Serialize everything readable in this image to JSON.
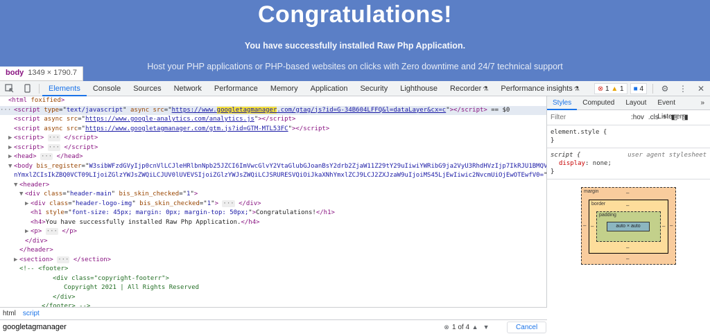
{
  "banner": {
    "title": "Congratulations!",
    "subtitle": "You have successfully installed Raw Php Application.",
    "text": "Host your PHP applications or PHP-based websites on clicks with Zero downtime and 24/7 technical support"
  },
  "tooltip": {
    "tag": "body",
    "dims": "1349 × 1790.7"
  },
  "devtools": {
    "tabs": [
      "Elements",
      "Console",
      "Sources",
      "Network",
      "Performance",
      "Memory",
      "Application",
      "Security",
      "Lighthouse",
      "Recorder",
      "Performance insights"
    ],
    "badges": {
      "errors": "1",
      "warnings": "1",
      "messages": "4"
    }
  },
  "dom": [
    {
      "indent": 0,
      "html": "<span class='tag'>&lt;html</span> <span class='attr'>foxified</span><span class='tag'>&gt;</span>"
    },
    {
      "indent": 1,
      "sel": true,
      "html": "<span class='tag'>&lt;script</span> <span class='attr'>type</span>=\"<span class='val'>text/javascript</span>\" <span class='attr'>async</span> <span class='attr'>src</span>=\"<span class='link'>https://www.<span class='hl'>googletagmanager</span>.com/gtag/js?id=G-34B604LFFQ&amp;l=dataLayer&amp;cx=c</span>\"<span class='tag'>&gt;&lt;/script&gt;</span> <span class='txt'>== $0</span>",
      "prefix": "···"
    },
    {
      "indent": 1,
      "html": "<span class='tag'>&lt;script</span> <span class='attr'>async</span> <span class='attr'>src</span>=\"<span class='link'>https://www.google-analytics.com/analytics.js</span>\"<span class='tag'>&gt;&lt;/script&gt;</span>"
    },
    {
      "indent": 1,
      "html": "<span class='tag'>&lt;script</span> <span class='attr'>async</span> <span class='attr'>src</span>=\"<span class='link'>https://www.googletagmanager.com/gtm.js?id=GTM-MTL53FC</span>\"<span class='tag'>&gt;&lt;/script&gt;</span>"
    },
    {
      "indent": 1,
      "arrow": "▶",
      "html": "<span class='tag'>&lt;script&gt;</span> <span class='dots'>···</span> <span class='tag'>&lt;/script&gt;</span>"
    },
    {
      "indent": 1,
      "arrow": "▶",
      "html": "<span class='tag'>&lt;script&gt;</span> <span class='dots'>···</span> <span class='tag'>&lt;/script&gt;</span>"
    },
    {
      "indent": 1,
      "arrow": "▶",
      "html": "<span class='tag'>&lt;head&gt;</span> <span class='dots'>···</span> <span class='tag'>&lt;/head&gt;</span>"
    },
    {
      "indent": 1,
      "arrow": "▼",
      "html": "<span class='tag'>&lt;body</span> <span class='attr'>bis_register</span>=\"<span class='val'>W3sibWFzdGVyIjp0cnVlLCJleHRlbnNpb25JZCI6ImVwcGlvY2VtaGlubGJoanBsY2drb2ZjaW11Z29tY29uIiwiYWRibG9ja2VyU3RhdHVzIjp7IkRJU1BMQVkiOiJkaXN</span>"
    },
    {
      "indent": 1,
      "html": "<span class='val'>nYmxlZCIsIkZBQ0VCT09LIjoiZGlzYWJsZWQiLCJUV0lUVEVSIjoiZGlzYWJsZWQiLCJSRURESVQiOiJkaXNhYmxlZCJ9LCJ2ZXJzaW9uIjoiMS45LjEwIiwic2NvcmUiOjEwOTEwfV0=</span>\" <span class='attr'>data-new-gr-c-s-check-loaded</span>=\"<span class='val'>14.1111.0</span>\" <span class='attr'>data-gr-ext-installed</span> <span class='attr'>cz-shortcut-listen</span>=\"<span class='val'>true</span>\"<span class='tag'>&gt;</span>"
    },
    {
      "indent": 2,
      "arrow": "▼",
      "html": "<span class='tag'>&lt;header&gt;</span>"
    },
    {
      "indent": 3,
      "arrow": "▼",
      "html": "<span class='tag'>&lt;div</span> <span class='attr'>class</span>=\"<span class='val'>header-main</span>\" <span class='attr'>bis_skin_checked</span>=\"<span class='val'>1</span>\"<span class='tag'>&gt;</span>"
    },
    {
      "indent": 4,
      "arrow": "▶",
      "html": "<span class='tag'>&lt;div</span> <span class='attr'>class</span>=\"<span class='val'>header-logo-img</span>\" <span class='attr'>bis_skin_checked</span>=\"<span class='val'>1</span>\"<span class='tag'>&gt;</span> <span class='dots'>···</span> <span class='tag'>&lt;/div&gt;</span>"
    },
    {
      "indent": 4,
      "html": "<span class='tag'>&lt;h1</span> <span class='attr'>style</span>=\"<span class='val'>font-size: 45px; margin: 0px; margin-top: 50px;</span>\"<span class='tag'>&gt;</span><span class='txt'>Congratulations!</span><span class='tag'>&lt;/h1&gt;</span>"
    },
    {
      "indent": 4,
      "html": "<span class='tag'>&lt;h4&gt;</span><span class='txt'>You have successfully installed Raw Php Application.</span><span class='tag'>&lt;/h4&gt;</span>"
    },
    {
      "indent": 4,
      "arrow": "▶",
      "html": "<span class='tag'>&lt;p&gt;</span> <span class='dots'>···</span> <span class='tag'>&lt;/p&gt;</span>"
    },
    {
      "indent": 3,
      "html": "<span class='tag'>&lt;/div&gt;</span>"
    },
    {
      "indent": 2,
      "html": "<span class='tag'>&lt;/header&gt;</span>"
    },
    {
      "indent": 2,
      "arrow": "▶",
      "html": "<span class='tag'>&lt;section&gt;</span> <span class='dots'>···</span> <span class='tag'>&lt;/section&gt;</span>"
    },
    {
      "indent": 2,
      "html": "<span class='com'>&lt;!-- &lt;footer&gt;</span>"
    },
    {
      "indent": 8,
      "html": "<span class='com'>&lt;div class=\"copyright-footerr\"&gt;</span>"
    },
    {
      "indent": 10,
      "html": "<span class='com'>Copyright 2021 | All Rights Reserved</span>"
    },
    {
      "indent": 8,
      "html": "<span class='com'>&lt;/div&gt;</span>"
    },
    {
      "indent": 6,
      "html": "<span class='com'>&lt;/footer&gt; --&gt;</span>"
    }
  ],
  "crumbs": [
    "html",
    "script"
  ],
  "search": {
    "value": "googletagmanager",
    "count": "1 of 4",
    "cancel": "Cancel"
  },
  "sidebar": {
    "tabs": [
      "Styles",
      "Computed",
      "Layout",
      "Event Listeners"
    ],
    "filter_placeholder": "Filter",
    "hov": ":hov",
    "cls": ".cls",
    "rule1": {
      "selector": "element.style {",
      "close": "}"
    },
    "rule2": {
      "selector": "script {",
      "source": "user agent stylesheet",
      "prop": "display",
      "value": "none;",
      "close": "}"
    },
    "boxmodel": {
      "margin": "margin",
      "border": "border",
      "padding": "padding",
      "content": "auto × auto",
      "dash": "–"
    }
  }
}
